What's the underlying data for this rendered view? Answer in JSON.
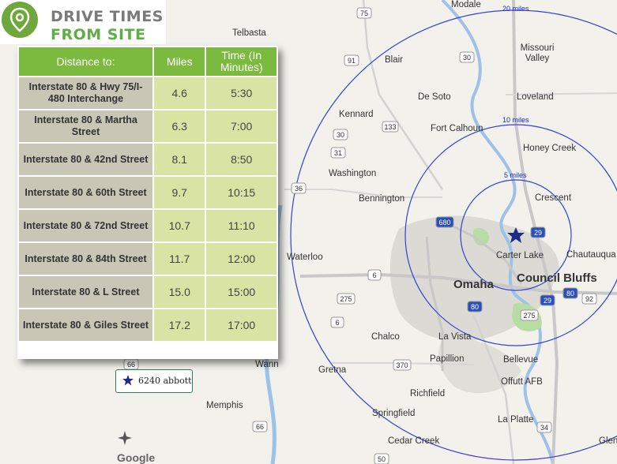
{
  "header": {
    "title_line1": "DRIVE TIMES",
    "title_line2": "FROM SITE"
  },
  "table": {
    "headers": [
      "Distance to:",
      "Miles",
      "Time (In Minutes)"
    ],
    "rows": [
      {
        "destination": "Interstate 80 & Hwy 75/I-480 Interchange",
        "miles": "4.6",
        "time": "5:30"
      },
      {
        "destination": "Interstate 80 & Martha Street",
        "miles": "6.3",
        "time": "7:00"
      },
      {
        "destination": "Interstate 80 & 42nd Street",
        "miles": "8.1",
        "time": "8:50"
      },
      {
        "destination": "Interstate 80 & 60th Street",
        "miles": "9.7",
        "time": "10:15"
      },
      {
        "destination": "Interstate 80 & 72nd Street",
        "miles": "10.7",
        "time": "11:10"
      },
      {
        "destination": "Interstate 80 & 84th Street",
        "miles": "11.7",
        "time": "12:00"
      },
      {
        "destination": "Interstate 80 & L Street",
        "miles": "15.0",
        "time": "15:00"
      },
      {
        "destination": "Interstate 80 & Giles Street",
        "miles": "17.2",
        "time": "17:00"
      }
    ]
  },
  "legend": {
    "label": "6240 abbott"
  },
  "map": {
    "ring_labels": [
      "20 miles",
      "10 miles",
      "5 miles"
    ],
    "places": {
      "modale": "Modale",
      "telbasta": "Telbasta",
      "blair": "Blair",
      "missouri_valley": "Missouri Valley",
      "kennard": "Kennard",
      "de_soto": "De Soto",
      "loveland": "Loveland",
      "fort_calhoun": "Fort Calhoun",
      "honey_creek": "Honey Creek",
      "washington": "Washington",
      "crescent": "Crescent",
      "bennington": "Bennington",
      "carter_lake": "Carter Lake",
      "chautauqua": "Chautauqua",
      "waterloo": "Waterloo",
      "omaha": "Omaha",
      "council_bluffs": "Council Bluffs",
      "chalco": "Chalco",
      "la_vista": "La Vista",
      "bellevue": "Bellevue",
      "papillion": "Papillion",
      "gretna": "Gretna",
      "wann": "Wann",
      "offutt_afb": "Offutt AFB",
      "richfield": "Richfield",
      "memphis": "Memphis",
      "springfield": "Springfield",
      "la_platte": "La Platte",
      "cedar_creek": "Cedar Creek",
      "glen": "Glen"
    },
    "route_shields": [
      "75",
      "30",
      "91",
      "30",
      "133",
      "31",
      "36",
      "680",
      "29",
      "6",
      "275",
      "6",
      "370",
      "80",
      "80",
      "92",
      "29",
      "275",
      "34",
      "66",
      "66",
      "50"
    ],
    "attribution": "Google"
  },
  "colors": {
    "header_green": "#7cba3f",
    "title_grey": "#7a7a7a",
    "title_green": "#5fae45",
    "destination_cell": "#c9c6b6",
    "number_cell": "#d9e3a4",
    "ring_blue": "#3b3fd0",
    "site_star": "#1c2a8c"
  },
  "icons": {
    "logo": "map-pin-icon",
    "site": "star-icon",
    "compass": "compass-icon"
  }
}
